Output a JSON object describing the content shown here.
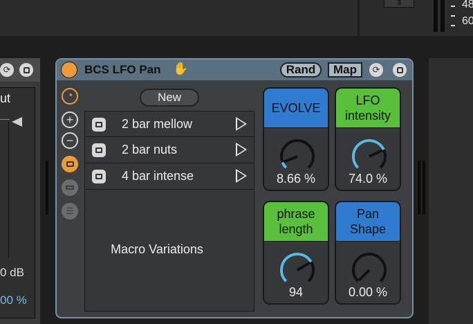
{
  "top": {
    "box_label": "3",
    "meter_values": [
      "48",
      "60"
    ]
  },
  "left_device": {
    "partial_label": "ut",
    "db_readout": "0 dB",
    "percent_readout": "00 %"
  },
  "device": {
    "title": "BCS LFO Pan",
    "rand_label": "Rand",
    "map_label": "Map",
    "accent_color": "#ee9a3a",
    "header_color": "#5a7080"
  },
  "side_tools": [
    "variation-mode-icon",
    "plus-icon",
    "minus-icon",
    "camera-icon",
    "square-icon",
    "list-icon"
  ],
  "variations": {
    "new_label": "New",
    "items": [
      {
        "label": "2 bar mellow"
      },
      {
        "label": "2 bar nuts"
      },
      {
        "label": "4 bar intense"
      }
    ],
    "panel_label": "Macro Variations"
  },
  "macros": [
    {
      "name": "EVOLVE",
      "value": "8.66 %",
      "color": "#2f7bd0",
      "level": 0.0866
    },
    {
      "name": "LFO\nintensity",
      "line1": "LFO",
      "line2": "intensity",
      "value": "74.0 %",
      "color": "#58c03a",
      "level": 0.74
    },
    {
      "name": "phrase\nlength",
      "line1": "phrase",
      "line2": "length",
      "value": "94",
      "color": "#58c03a",
      "level": 0.72
    },
    {
      "name": "Pan\nShape",
      "line1": "Pan",
      "line2": "Shape",
      "value": "0.00 %",
      "color": "#2f7bd0",
      "level": 0
    }
  ]
}
